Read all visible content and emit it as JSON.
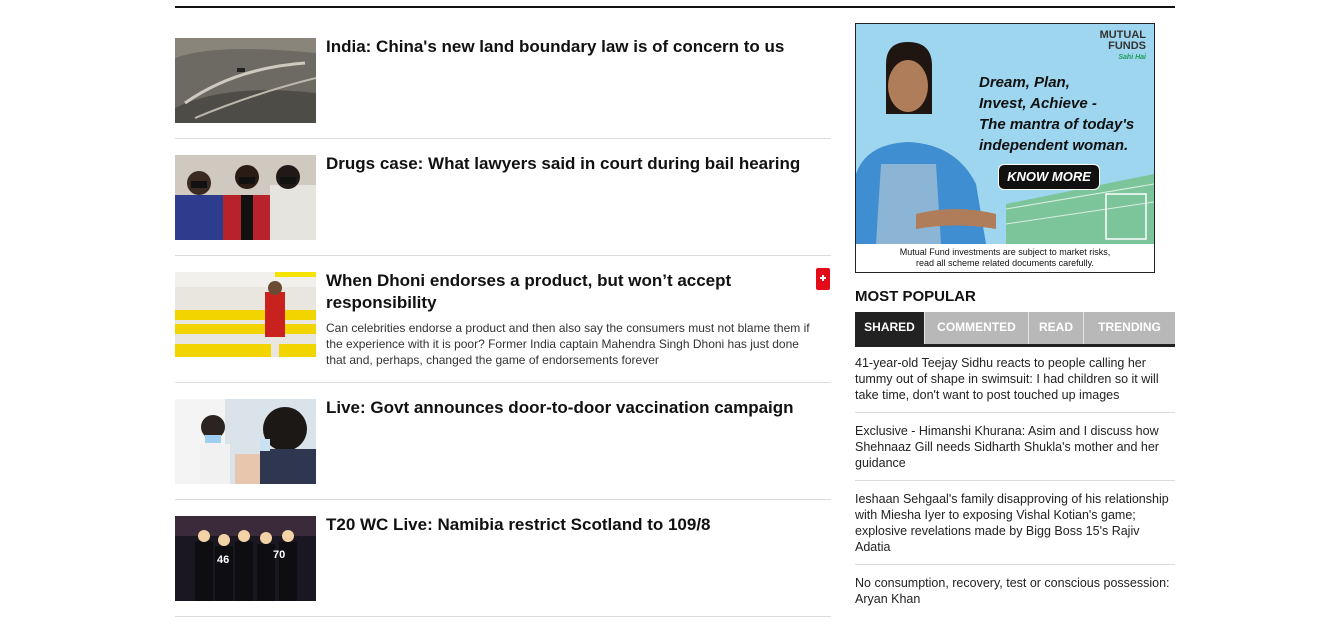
{
  "news": [
    {
      "headline": "India: China's new land boundary law is of concern to us",
      "summary": ""
    },
    {
      "headline": "Drugs case: What lawyers said in court during bail hearing",
      "summary": ""
    },
    {
      "headline": "When Dhoni endorses a product, but won’t accept responsibility",
      "summary": "Can celebrities endorse a product and then also say the consumers must not blame them if the experience with it is poor? Former India captain Mahendra Singh Dhoni has just done that and, perhaps, changed the game of endorsements forever"
    },
    {
      "headline": "Live: Govt announces door-to-door vaccination campaign",
      "summary": ""
    },
    {
      "headline": "T20 WC Live: Namibia restrict Scotland to 109/8",
      "summary": ""
    }
  ],
  "ad": {
    "brand_line1": "MUTUAL",
    "brand_line2": "FUNDS",
    "brand_tag": "Sahi Hai",
    "lines": [
      "Dream, Plan,",
      "Invest, Achieve -",
      "The mantra of today's",
      "independent woman."
    ],
    "button": "KNOW MORE",
    "disclaimer1": "Mutual Fund investments are subject to market risks,",
    "disclaimer2": "read all scheme related documents carefully."
  },
  "popular": {
    "title": "MOST POPULAR",
    "tabs": [
      "SHARED",
      "COMMENTED",
      "READ",
      "TRENDING"
    ],
    "active_tab": "SHARED",
    "items": [
      "41-year-old Teejay Sidhu reacts to people calling her tummy out of shape in swimsuit: I had children so it will take time, don't want to post touched up images",
      "Exclusive - Himanshi Khurana: Asim and I discuss how Shehnaaz Gill needs Sidharth Shukla's mother and her guidance",
      "Ieshaan Sehgaal's family disapproving of his relationship with Miesha Iyer to exposing Vishal Kotian's game; explosive revelations made by Bigg Boss 15's Rajiv Adatia",
      "No consumption, recovery, test or conscious possession: Aryan Khan"
    ]
  },
  "colors": {
    "accent_red": "#e30b17",
    "tab_active": "#222222",
    "tab_inactive": "#b8b8b8",
    "ad_bg": "#9fd6ef"
  }
}
